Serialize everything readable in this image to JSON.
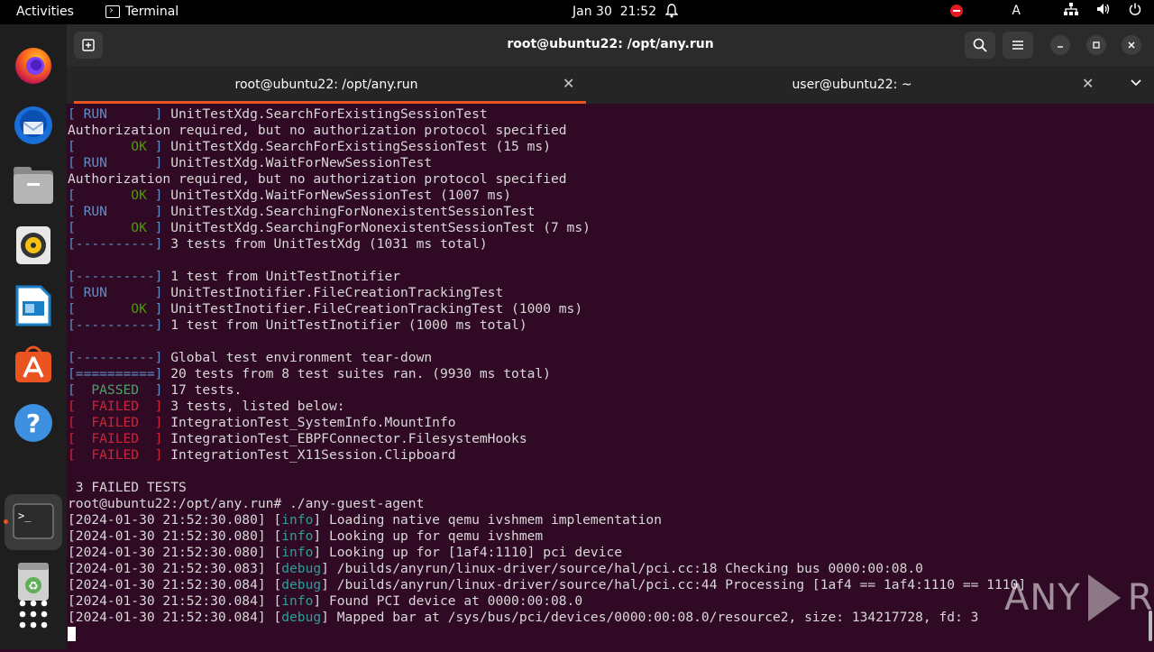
{
  "topbar": {
    "activities": "Activities",
    "app_name": "Terminal",
    "date": "Jan 30",
    "time": "21:52",
    "keyboard": "A"
  },
  "dock": {
    "items": [
      "firefox-icon",
      "thunderbird-icon",
      "files-icon",
      "rhythmbox-icon",
      "writer-icon",
      "app-center-icon",
      "help-icon",
      "terminal-icon",
      "trash-icon",
      "show-apps-icon"
    ]
  },
  "window": {
    "title": "root@ubuntu22: /opt/any.run",
    "tabs": [
      {
        "label": "root@ubuntu22: /opt/any.run",
        "active": true
      },
      {
        "label": "user@ubuntu22: ~",
        "active": false
      }
    ]
  },
  "terminal": {
    "lines": [
      [
        [
          "blue",
          "[ RUN      ]"
        ],
        [
          "plain",
          " UnitTestXdg.SearchForExistingSessionTest"
        ]
      ],
      [
        [
          "plain",
          "Authorization required, but no authorization protocol specified"
        ]
      ],
      [
        [
          "blue",
          "[       "
        ],
        [
          "green",
          "OK"
        ],
        [
          "blue",
          " ]"
        ],
        [
          "plain",
          " UnitTestXdg.SearchForExistingSessionTest (15 ms)"
        ]
      ],
      [
        [
          "blue",
          "[ RUN      ]"
        ],
        [
          "plain",
          " UnitTestXdg.WaitForNewSessionTest"
        ]
      ],
      [
        [
          "plain",
          "Authorization required, but no authorization protocol specified"
        ]
      ],
      [
        [
          "blue",
          "[       "
        ],
        [
          "green",
          "OK"
        ],
        [
          "blue",
          " ]"
        ],
        [
          "plain",
          " UnitTestXdg.WaitForNewSessionTest (1007 ms)"
        ]
      ],
      [
        [
          "blue",
          "[ RUN      ]"
        ],
        [
          "plain",
          " UnitTestXdg.SearchingForNonexistentSessionTest"
        ]
      ],
      [
        [
          "blue",
          "[       "
        ],
        [
          "green",
          "OK"
        ],
        [
          "blue",
          " ]"
        ],
        [
          "plain",
          " UnitTestXdg.SearchingForNonexistentSessionTest (7 ms)"
        ]
      ],
      [
        [
          "blue",
          "[----------]"
        ],
        [
          "plain",
          " 3 tests from UnitTestXdg (1031 ms total)"
        ]
      ],
      [
        [
          "plain",
          ""
        ]
      ],
      [
        [
          "blue",
          "[----------]"
        ],
        [
          "plain",
          " 1 test from UnitTestInotifier"
        ]
      ],
      [
        [
          "blue",
          "[ RUN      ]"
        ],
        [
          "plain",
          " UnitTestInotifier.FileCreationTrackingTest"
        ]
      ],
      [
        [
          "blue",
          "[       "
        ],
        [
          "green",
          "OK"
        ],
        [
          "blue",
          " ]"
        ],
        [
          "plain",
          " UnitTestInotifier.FileCreationTrackingTest (1000 ms)"
        ]
      ],
      [
        [
          "blue",
          "[----------]"
        ],
        [
          "plain",
          " 1 test from UnitTestInotifier (1000 ms total)"
        ]
      ],
      [
        [
          "plain",
          ""
        ]
      ],
      [
        [
          "blue",
          "[----------]"
        ],
        [
          "plain",
          " Global test environment tear-down"
        ]
      ],
      [
        [
          "blue",
          "[==========]"
        ],
        [
          "plain",
          " 20 tests from 8 test suites ran. (9930 ms total)"
        ]
      ],
      [
        [
          "blue",
          "[  "
        ],
        [
          "passed",
          "PASSED"
        ],
        [
          "blue",
          "  ]"
        ],
        [
          "plain",
          " 17 tests."
        ]
      ],
      [
        [
          "red",
          "[  FAILED  ]"
        ],
        [
          "plain",
          " 3 tests, listed below:"
        ]
      ],
      [
        [
          "red",
          "[  FAILED  ]"
        ],
        [
          "plain",
          " IntegrationTest_SystemInfo.MountInfo"
        ]
      ],
      [
        [
          "red",
          "[  FAILED  ]"
        ],
        [
          "plain",
          " IntegrationTest_EBPFConnector.FilesystemHooks"
        ]
      ],
      [
        [
          "red",
          "[  FAILED  ]"
        ],
        [
          "plain",
          " IntegrationTest_X11Session.Clipboard"
        ]
      ],
      [
        [
          "plain",
          ""
        ]
      ],
      [
        [
          "plain",
          " 3 FAILED TESTS"
        ]
      ],
      [
        [
          "plain",
          "root@ubuntu22:/opt/any.run# ./any-guest-agent"
        ]
      ],
      [
        [
          "plain",
          "[2024-01-30 21:52:30.080] ["
        ],
        [
          "teal",
          "info"
        ],
        [
          "plain",
          "] Loading native qemu ivshmem implementation"
        ]
      ],
      [
        [
          "plain",
          "[2024-01-30 21:52:30.080] ["
        ],
        [
          "teal",
          "info"
        ],
        [
          "plain",
          "] Looking up for qemu ivshmem"
        ]
      ],
      [
        [
          "plain",
          "[2024-01-30 21:52:30.080] ["
        ],
        [
          "teal",
          "info"
        ],
        [
          "plain",
          "] Looking up for [1af4:1110] pci device"
        ]
      ],
      [
        [
          "plain",
          "[2024-01-30 21:52:30.083] ["
        ],
        [
          "teal",
          "debug"
        ],
        [
          "plain",
          "] /builds/anyrun/linux-driver/source/hal/pci.cc:18 Checking bus 0000:00:08.0"
        ]
      ],
      [
        [
          "plain",
          "[2024-01-30 21:52:30.084] ["
        ],
        [
          "teal",
          "debug"
        ],
        [
          "plain",
          "] /builds/anyrun/linux-driver/source/hal/pci.cc:44 Processing [1af4 == 1af4:1110 == 1110]"
        ]
      ],
      [
        [
          "plain",
          "[2024-01-30 21:52:30.084] ["
        ],
        [
          "teal",
          "info"
        ],
        [
          "plain",
          "] Found PCI device at 0000:00:08.0"
        ]
      ],
      [
        [
          "plain",
          "[2024-01-30 21:52:30.084] ["
        ],
        [
          "teal",
          "debug"
        ],
        [
          "plain",
          "] Mapped bar at /sys/bus/pci/devices/0000:00:08.0/resource2, size: 134217728, fd: 3"
        ]
      ]
    ]
  },
  "watermark": {
    "left": "ANY",
    "right": "RUN"
  }
}
